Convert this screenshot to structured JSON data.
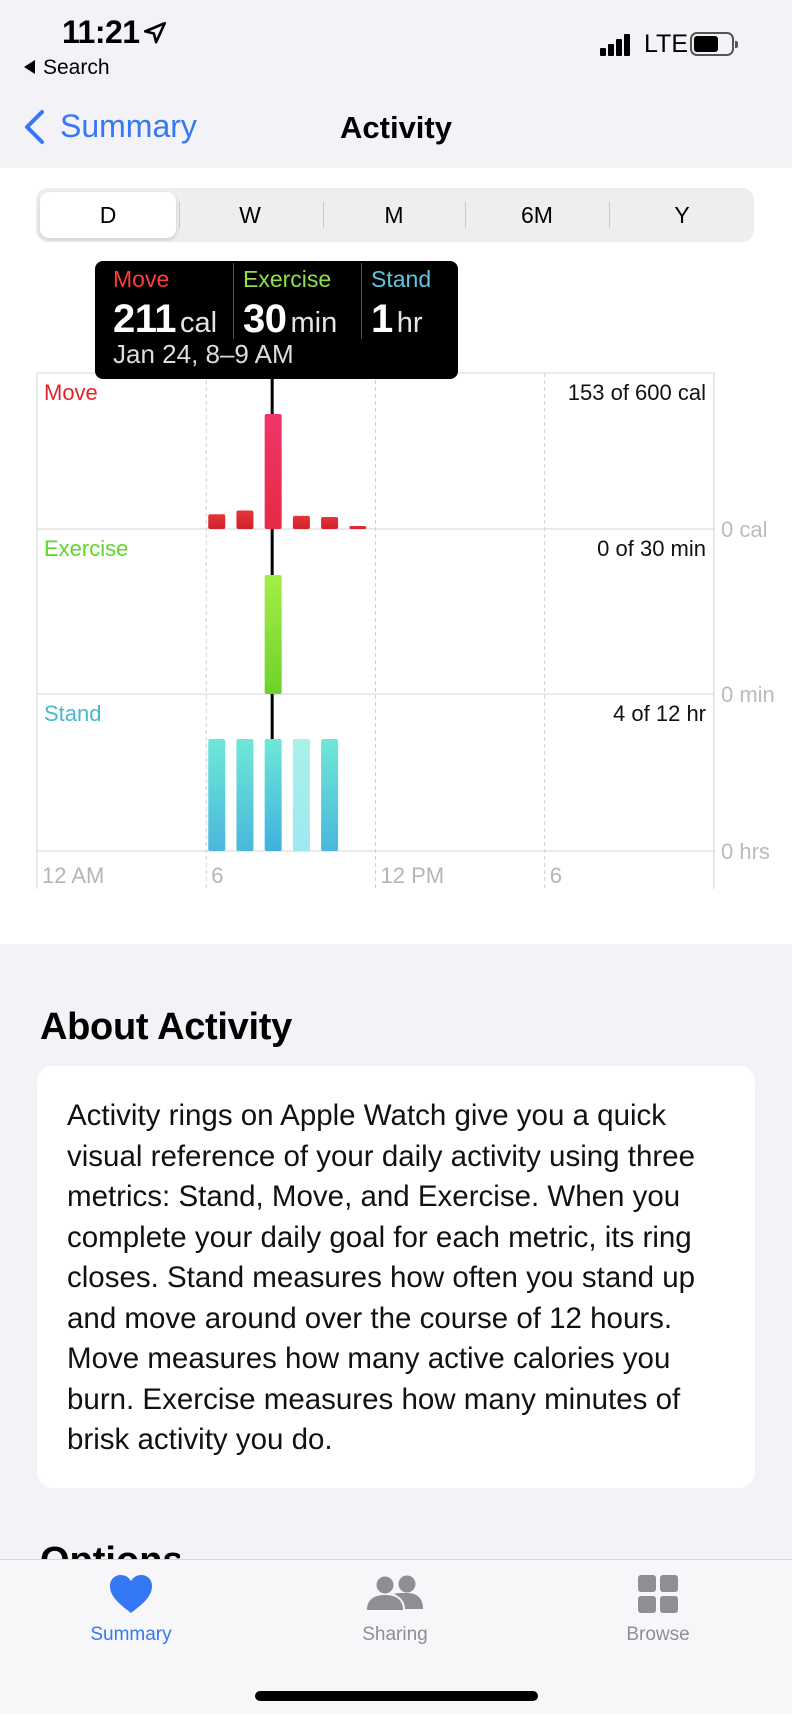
{
  "status": {
    "time": "11:21",
    "back_app": "Search",
    "network": "LTE"
  },
  "nav": {
    "back_label": "Summary",
    "title": "Activity"
  },
  "segments": [
    "D",
    "W",
    "M",
    "6M",
    "Y"
  ],
  "selected_segment": "D",
  "tooltip": {
    "move_label": "Move",
    "move_value": "211",
    "move_unit": "cal",
    "exercise_label": "Exercise",
    "exercise_value": "30",
    "exercise_unit": "min",
    "stand_label": "Stand",
    "stand_value": "1",
    "stand_unit": "hr",
    "date": "Jan 24, 8–9 AM"
  },
  "colors": {
    "move": "#e0242e",
    "move_highlight": "#ec2f5b",
    "exercise": "#7ae22a",
    "stand": "#5cc8dd",
    "accent": "#3478f6"
  },
  "chart_data": [
    {
      "type": "bar",
      "name": "Move",
      "summary": "153 of 600 cal",
      "axis_label": "0 cal",
      "unit": "cal",
      "x": [
        6,
        7,
        8,
        9,
        10,
        11
      ],
      "values": [
        27,
        34,
        211,
        24,
        22,
        4
      ],
      "highlight_x": 8,
      "ylim": [
        0,
        211
      ]
    },
    {
      "type": "bar",
      "name": "Exercise",
      "summary": "0 of 30 min",
      "axis_label": "0 min",
      "unit": "min",
      "x": [
        8
      ],
      "values": [
        30
      ],
      "highlight_x": 8,
      "ylim": [
        0,
        30
      ]
    },
    {
      "type": "bar",
      "name": "Stand",
      "summary": "4 of 12 hr",
      "axis_label": "0 hrs",
      "unit": "hr",
      "x": [
        6,
        7,
        8,
        9,
        10
      ],
      "values": [
        1,
        1,
        1,
        1,
        1
      ],
      "highlight_x": 8,
      "ylim": [
        0,
        1
      ]
    }
  ],
  "x_ticks": [
    "12 AM",
    "6",
    "12 PM",
    "6"
  ],
  "about": {
    "title": "About Activity",
    "text": "Activity rings on Apple Watch give you a quick visual reference of your daily activity using three metrics: Stand, Move, and Exercise. When you complete your daily goal for each metric, its ring closes. Stand measures how often you stand up and move around over the course of 12 hours. Move measures how many active calories you burn. Exercise measures how many minutes of brisk activity you do.",
    "next_section_peek": "Options"
  },
  "tabs": [
    {
      "label": "Summary",
      "icon": "heart-icon",
      "active": true
    },
    {
      "label": "Sharing",
      "icon": "people-icon",
      "active": false
    },
    {
      "label": "Browse",
      "icon": "grid-icon",
      "active": false
    }
  ]
}
